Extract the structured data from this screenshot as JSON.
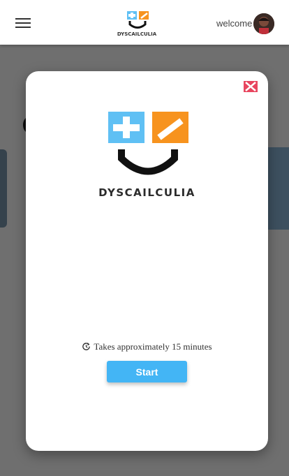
{
  "header": {
    "menu_icon": "hamburger-menu-icon",
    "logo_text": "DYSCAILCULIA",
    "welcome_text": "welcome",
    "avatar": "user-avatar"
  },
  "modal": {
    "close_icon": "close-icon",
    "brand_name": "DYSCAILCULIA",
    "duration_icon": "clock-refresh-icon",
    "duration_text": "Takes approximately 15 minutes",
    "start_label": "Start"
  },
  "colors": {
    "accent_blue": "#43b5f5",
    "logo_blue": "#5fc0f4",
    "logo_orange": "#f7931e",
    "close_red": "#e8465f"
  }
}
